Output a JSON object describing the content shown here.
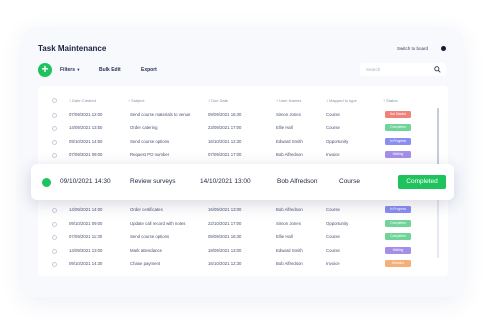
{
  "header": {
    "title": "Task Maintenance",
    "switch_label": "Switch to board"
  },
  "toolbar": {
    "add_label": "+",
    "filters_label": "Filters",
    "bulk_edit_label": "Bulk Edit",
    "export_label": "Export"
  },
  "search": {
    "placeholder": "Search"
  },
  "columns": [
    "Date Created",
    "Subject",
    "Due Date",
    "User Names",
    "Mapped to type",
    "Status"
  ],
  "rows": [
    {
      "created": "07/09/2021  12:00",
      "subject": "Send course materials to venue",
      "due": "09/09/2021  16:30",
      "user": "Simon Jones",
      "type": "Course",
      "status": "Not Started",
      "color": "#f0807a"
    },
    {
      "created": "14/09/2021  13:50",
      "subject": "Order catering",
      "due": "23/09/2021  17:00",
      "user": "Ellie Hall",
      "type": "Course",
      "status": "Completed",
      "color": "#6fd39a"
    },
    {
      "created": "09/10/2021  14:50",
      "subject": "Send course options",
      "due": "16/10/2021  12:30",
      "user": "Edward Smith",
      "type": "Opportunity",
      "status": "In Progress",
      "color": "#8a8ef0"
    },
    {
      "created": "07/09/2021  09:00",
      "subject": "Request PO number",
      "due": "07/09/2021  17:00",
      "user": "Bob Alfredson",
      "type": "Invoice",
      "status": "Waiting",
      "color": "#a48ee8"
    },
    {
      "created": "14/09/2021  14:00",
      "subject": "Order certificates",
      "due": "16/09/2021  13:00",
      "user": "Bob Alfredson",
      "type": "Course",
      "status": "In Progress",
      "color": "#8a8ef0"
    },
    {
      "created": "09/10/2021  09:00",
      "subject": "Update call record with notes",
      "due": "22/10/2021  17:00",
      "user": "Simon Jones",
      "type": "Opportunity",
      "status": "Completed",
      "color": "#6fd39a"
    },
    {
      "created": "07/09/2021  11:30",
      "subject": "Send course options",
      "due": "09/09/2021  16:30",
      "user": "Ellie Hall",
      "type": "Course",
      "status": "Completed",
      "color": "#6fd39a"
    },
    {
      "created": "14/09/2021  13:00",
      "subject": "Mark attendance",
      "due": "18/09/2021  13:00",
      "user": "Edward Smith",
      "type": "Course",
      "status": "Waiting",
      "color": "#a48ee8"
    },
    {
      "created": "09/10/2021  14:30",
      "subject": "Chase payment",
      "due": "16/10/2021  12:30",
      "user": "Bob Alfredson",
      "type": "Invoice",
      "status": "Overdue",
      "color": "#f5b07a"
    }
  ],
  "highlight": {
    "created": "09/10/2021  14:30",
    "subject": "Review surveys",
    "due": "14/10/2021  13:00",
    "user": "Bob Alfredson",
    "type": "Course",
    "status": "Completed"
  }
}
